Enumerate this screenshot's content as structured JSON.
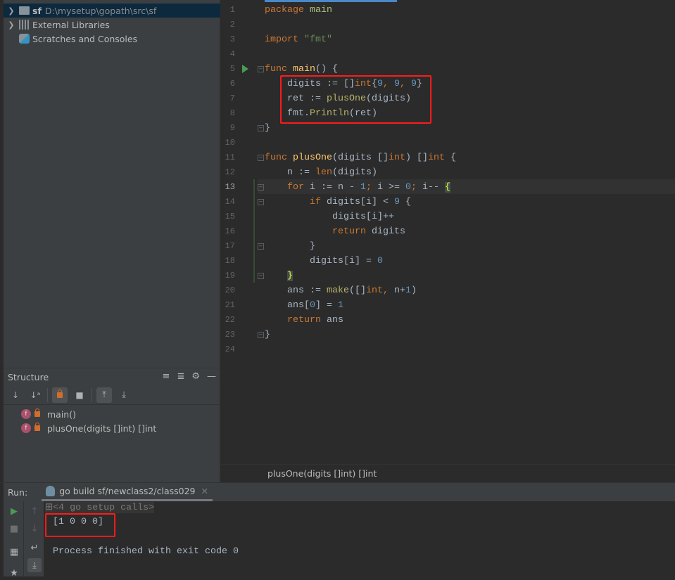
{
  "project_tree": {
    "items": [
      {
        "name": "sf",
        "path": "D:\\mysetup\\gopath\\src\\sf",
        "icon": "folder-icon"
      },
      {
        "name": "External Libraries",
        "icon": "libraries-icon"
      },
      {
        "name": "Scratches and Consoles",
        "icon": "scratches-icon"
      }
    ]
  },
  "structure": {
    "title": "Structure",
    "items": [
      {
        "label": "main()",
        "badge": "f"
      },
      {
        "label": "plusOne(digits []int) []int",
        "badge": "f"
      }
    ]
  },
  "editor": {
    "breadcrumb": "plusOne(digits []int) []int",
    "current_line": 13,
    "colors": {
      "keyword": "#cc7832",
      "text": "#a9b7c6",
      "number": "#6897bb",
      "string": "#6a8759",
      "function": "#ffc66d"
    },
    "lines": [
      [
        [
          "package",
          "kw"
        ],
        [
          " ",
          "tx"
        ],
        [
          "main",
          "pk"
        ]
      ],
      [],
      [
        [
          "import",
          "kw"
        ],
        [
          " ",
          "tx"
        ],
        [
          "\"fmt\"",
          "str"
        ]
      ],
      [],
      [
        [
          "func",
          "kw"
        ],
        [
          " ",
          "tx"
        ],
        [
          "main",
          "fn"
        ],
        [
          "() {",
          "tx"
        ]
      ],
      [
        [
          "    digits := []",
          "tx"
        ],
        [
          "int",
          "kw"
        ],
        [
          "{",
          "tx"
        ],
        [
          "9",
          "num"
        ],
        [
          ", ",
          "kw"
        ],
        [
          "9",
          "num"
        ],
        [
          ", ",
          "kw"
        ],
        [
          "9",
          "num"
        ],
        [
          "}",
          "tx"
        ]
      ],
      [
        [
          "    ret := ",
          "tx"
        ],
        [
          "plusOne",
          "call"
        ],
        [
          "(digits)",
          "tx"
        ]
      ],
      [
        [
          "    fmt.",
          "tx"
        ],
        [
          "Println",
          "call"
        ],
        [
          "(ret)",
          "tx"
        ]
      ],
      [
        [
          "}",
          "tx"
        ]
      ],
      [],
      [
        [
          "func",
          "kw"
        ],
        [
          " ",
          "tx"
        ],
        [
          "plusOne",
          "fn"
        ],
        [
          "(digits []",
          "tx"
        ],
        [
          "int",
          "kw"
        ],
        [
          ") []",
          "tx"
        ],
        [
          "int",
          "kw"
        ],
        [
          " {",
          "tx"
        ]
      ],
      [
        [
          "    n := ",
          "tx"
        ],
        [
          "len",
          "kw"
        ],
        [
          "(digits)",
          "tx"
        ]
      ],
      [
        [
          "    ",
          "tx"
        ],
        [
          "for",
          "kw"
        ],
        [
          " i := n - ",
          "tx"
        ],
        [
          "1",
          "num"
        ],
        [
          ";",
          "kw"
        ],
        [
          " i >= ",
          "tx"
        ],
        [
          "0",
          "num"
        ],
        [
          ";",
          "kw"
        ],
        [
          " i-- ",
          "tx"
        ],
        [
          "{",
          "br"
        ]
      ],
      [
        [
          "        ",
          "tx"
        ],
        [
          "if",
          "kw"
        ],
        [
          " digits[i] < ",
          "tx"
        ],
        [
          "9",
          "num"
        ],
        [
          " {",
          "tx"
        ]
      ],
      [
        [
          "            digits[i]++",
          "tx"
        ]
      ],
      [
        [
          "            ",
          "tx"
        ],
        [
          "return",
          "kw"
        ],
        [
          " digits",
          "tx"
        ]
      ],
      [
        [
          "        }",
          "tx"
        ]
      ],
      [
        [
          "        digits[i] = ",
          "tx"
        ],
        [
          "0",
          "num"
        ]
      ],
      [
        [
          "    ",
          "tx"
        ],
        [
          "}",
          "br"
        ]
      ],
      [
        [
          "    ans := ",
          "tx"
        ],
        [
          "make",
          "call"
        ],
        [
          "([]",
          "tx"
        ],
        [
          "int",
          "kw"
        ],
        [
          ", ",
          "kw"
        ],
        [
          "n+",
          "tx"
        ],
        [
          "1",
          "num"
        ],
        [
          ")",
          "tx"
        ]
      ],
      [
        [
          "    ans[",
          "tx"
        ],
        [
          "0",
          "num"
        ],
        [
          "] = ",
          "tx"
        ],
        [
          "1",
          "num"
        ]
      ],
      [
        [
          "    ",
          "tx"
        ],
        [
          "return",
          "kw"
        ],
        [
          " ans",
          "tx"
        ]
      ],
      [
        [
          "}",
          "tx"
        ]
      ],
      []
    ]
  },
  "run": {
    "label": "Run:",
    "tab": "go build sf/newclass2/class029",
    "console": {
      "collapsed": "<4 go setup calls>",
      "output": "[1 0 0 0]",
      "exit": "Process finished with exit code 0"
    }
  }
}
